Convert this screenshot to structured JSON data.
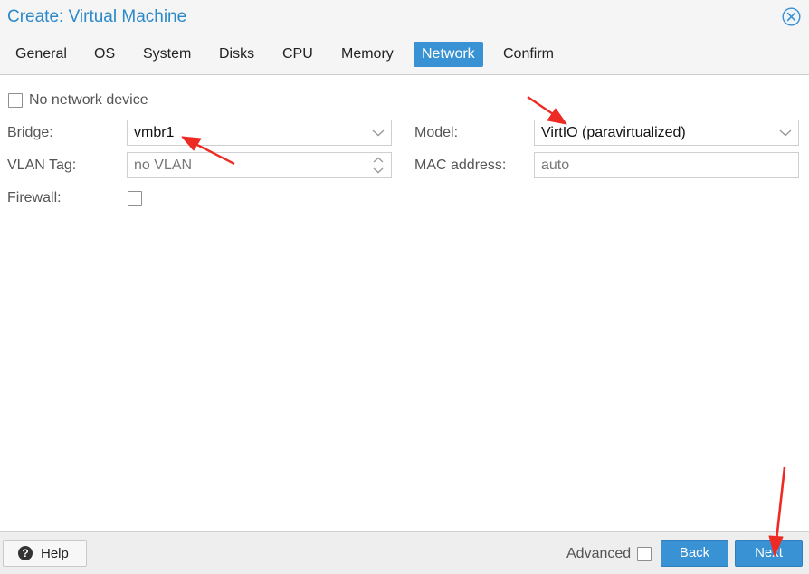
{
  "dialog": {
    "title": "Create: Virtual Machine"
  },
  "tabs": [
    {
      "label": "General",
      "active": false
    },
    {
      "label": "OS",
      "active": false
    },
    {
      "label": "System",
      "active": false
    },
    {
      "label": "Disks",
      "active": false
    },
    {
      "label": "CPU",
      "active": false
    },
    {
      "label": "Memory",
      "active": false
    },
    {
      "label": "Network",
      "active": true
    },
    {
      "label": "Confirm",
      "active": false
    }
  ],
  "form": {
    "no_network_device": {
      "label": "No network device",
      "checked": false
    },
    "bridge": {
      "label": "Bridge:",
      "value": "vmbr1"
    },
    "vlan_tag": {
      "label": "VLAN Tag:",
      "placeholder": "no VLAN"
    },
    "firewall": {
      "label": "Firewall:",
      "checked": false
    },
    "model": {
      "label": "Model:",
      "value": "VirtIO (paravirtualized)"
    },
    "mac_address": {
      "label": "MAC address:",
      "placeholder": "auto"
    }
  },
  "footer": {
    "help_label": "Help",
    "advanced_label": "Advanced",
    "advanced_checked": false,
    "back_label": "Back",
    "next_label": "Next"
  },
  "colors": {
    "accent": "#3892d4",
    "title": "#2b89c9",
    "annotation_arrow": "#ee2a24"
  },
  "icons": [
    "close-circle-icon",
    "chevron-down-icon",
    "spinner-updown-icon",
    "help-icon"
  ]
}
